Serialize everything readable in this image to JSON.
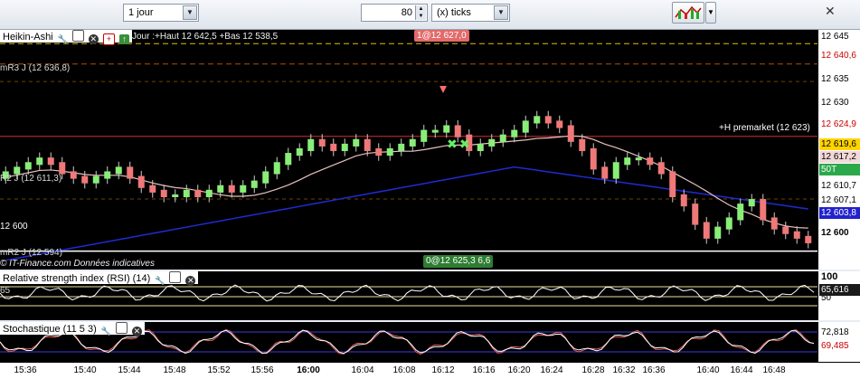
{
  "toolbar": {
    "period": "1 jour",
    "count": "80",
    "unit": "(x) ticks",
    "chart_type_icon": "candlestick-chart-icon",
    "close_icon": "close-icon"
  },
  "main": {
    "header": {
      "name": "Heikin-Ashi",
      "info": "Jour :+Haut 12 642,5 +Bas 12 538,5"
    },
    "order_tag_top": "1@12 627,0",
    "order_tag_bottom": "0@12 625,3 6,6",
    "watermark": "© IT-Finance.com Données indicatives",
    "levels": {
      "mR3": "mR3 J (12 636,8)",
      "r2": "R2 J (12 611,3)",
      "v12600": "12 600",
      "mR2": "mR2 J (12 594)",
      "premarket": "+H premarket (12 623)"
    },
    "y_ticks": [
      "12 645",
      "12 635",
      "12 630",
      "12 600"
    ],
    "y_tags": [
      {
        "text": "12 640,6",
        "color": "#cc0000",
        "bg": "#ffffff"
      },
      {
        "text": "12 624,9",
        "color": "#cc0000",
        "bg": "#ffffff"
      },
      {
        "text": "12 619,6",
        "color": "#000000",
        "bg": "#ffd400"
      },
      {
        "text": "12 617,2",
        "color": "#000000",
        "bg": "#f2d8d8"
      },
      {
        "text": "50T",
        "color": "#ffffff",
        "bg": "#2aa84a"
      },
      {
        "text": "12 610,7",
        "color": "#000000",
        "bg": "#ffffff"
      },
      {
        "text": "12 607,1",
        "color": "#000000",
        "bg": "#ffffff"
      },
      {
        "text": "12 603,8",
        "color": "#ffffff",
        "bg": "#2222cc"
      }
    ]
  },
  "rsi": {
    "title": "Relative strength index (RSI) (14)",
    "left_value": "65",
    "y_ticks": [
      "100",
      "50"
    ],
    "tag": "65,616"
  },
  "stoch": {
    "title": "Stochastique (11 5 3)",
    "tags": [
      "72,818",
      "69,485"
    ]
  },
  "x_ticks": [
    "15:36",
    "15:40",
    "15:44",
    "15:48",
    "15:52",
    "15:56",
    "16:00",
    "16:04",
    "16:08",
    "16:12",
    "16:16",
    "16:20",
    "16:24",
    "16:28",
    "16:32",
    "16:36",
    "16:40",
    "16:44",
    "16:48"
  ],
  "chart_data": {
    "type": "candlestick",
    "title": "Heikin-Ashi",
    "ylim": [
      12596,
      12648
    ],
    "series": [
      {
        "name": "Heikin-Ashi",
        "close": [
          12617,
          12618,
          12619,
          12620,
          12619,
          12617,
          12616,
          12615,
          12616,
          12617,
          12618,
          12616,
          12614,
          12613,
          12612,
          12612,
          12613,
          12612,
          12613,
          12614,
          12613,
          12614,
          12615,
          12617,
          12619,
          12621,
          12622,
          12624,
          12623,
          12622,
          12623,
          12624,
          12622,
          12621,
          12622,
          12623,
          12624,
          12626,
          12626,
          12627,
          12625,
          12622,
          12623,
          12624,
          12625,
          12626,
          12628,
          12629,
          12628,
          12627,
          12624,
          12622,
          12618,
          12616,
          12619,
          12620,
          12620,
          12619,
          12617,
          12612,
          12610,
          12606,
          12603,
          12605,
          12607,
          12610,
          12611,
          12607,
          12605,
          12604,
          12603,
          12602
        ]
      }
    ]
  }
}
